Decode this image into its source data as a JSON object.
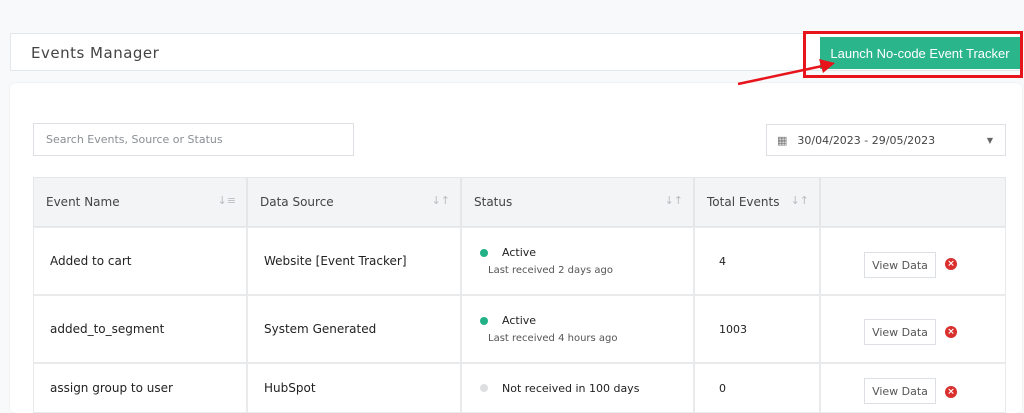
{
  "header": {
    "title": "Events Manager",
    "launch_button": "Launch No-code Event Tracker"
  },
  "filters": {
    "search_placeholder": "Search Events, Source or Status",
    "date_range": "30/04/2023 - 29/05/2023"
  },
  "table": {
    "columns": [
      "Event Name",
      "Data Source",
      "Status",
      "Total Events"
    ],
    "rows": [
      {
        "name": "Added to cart",
        "source": "Website [Event Tracker]",
        "status": "Active",
        "status_sub": "Last received 2 days ago",
        "total": "4",
        "status_color": "#22b187"
      },
      {
        "name": "added_to_segment",
        "source": "System Generated",
        "status": "Active",
        "status_sub": "Last received 4 hours ago",
        "total": "1003",
        "status_color": "#22b187"
      },
      {
        "name": "assign group to user",
        "source": "HubSpot",
        "status": "Not received in 100 days",
        "status_sub": "",
        "total": "0",
        "status_color": "#dedfe0"
      }
    ],
    "view_label": "View Data"
  },
  "colors": {
    "accent": "#2bb58a",
    "highlight": "#e8141c",
    "delete": "#d9302e"
  }
}
